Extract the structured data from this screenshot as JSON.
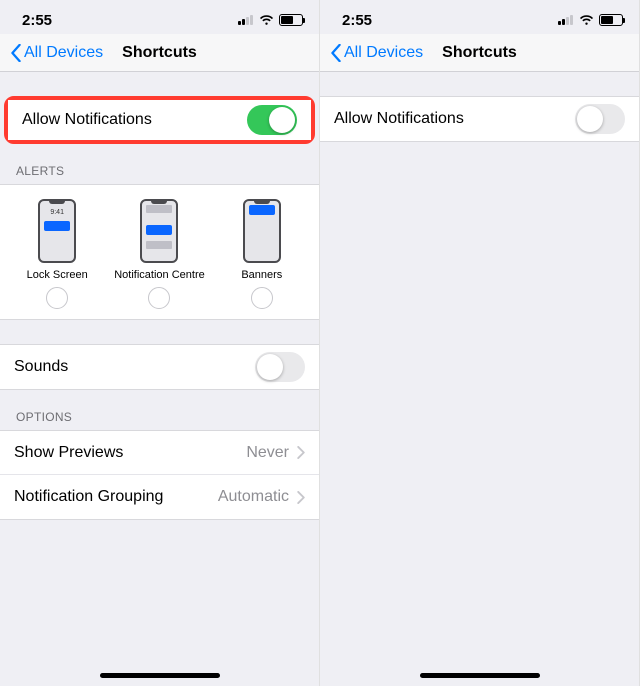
{
  "left": {
    "status": {
      "time": "2:55"
    },
    "nav": {
      "back": "All Devices",
      "title": "Shortcuts"
    },
    "allow_notifications": {
      "label": "Allow Notifications",
      "on": true
    },
    "alerts": {
      "header": "ALERTS",
      "items": [
        {
          "label": "Lock Screen",
          "checked": false
        },
        {
          "label": "Notification Centre",
          "checked": false
        },
        {
          "label": "Banners",
          "checked": false
        }
      ],
      "mock_time": "9:41"
    },
    "sounds": {
      "label": "Sounds",
      "on": false
    },
    "options": {
      "header": "OPTIONS",
      "rows": [
        {
          "label": "Show Previews",
          "value": "Never"
        },
        {
          "label": "Notification Grouping",
          "value": "Automatic"
        }
      ]
    }
  },
  "right": {
    "status": {
      "time": "2:55"
    },
    "nav": {
      "back": "All Devices",
      "title": "Shortcuts"
    },
    "allow_notifications": {
      "label": "Allow Notifications",
      "on": false
    }
  }
}
